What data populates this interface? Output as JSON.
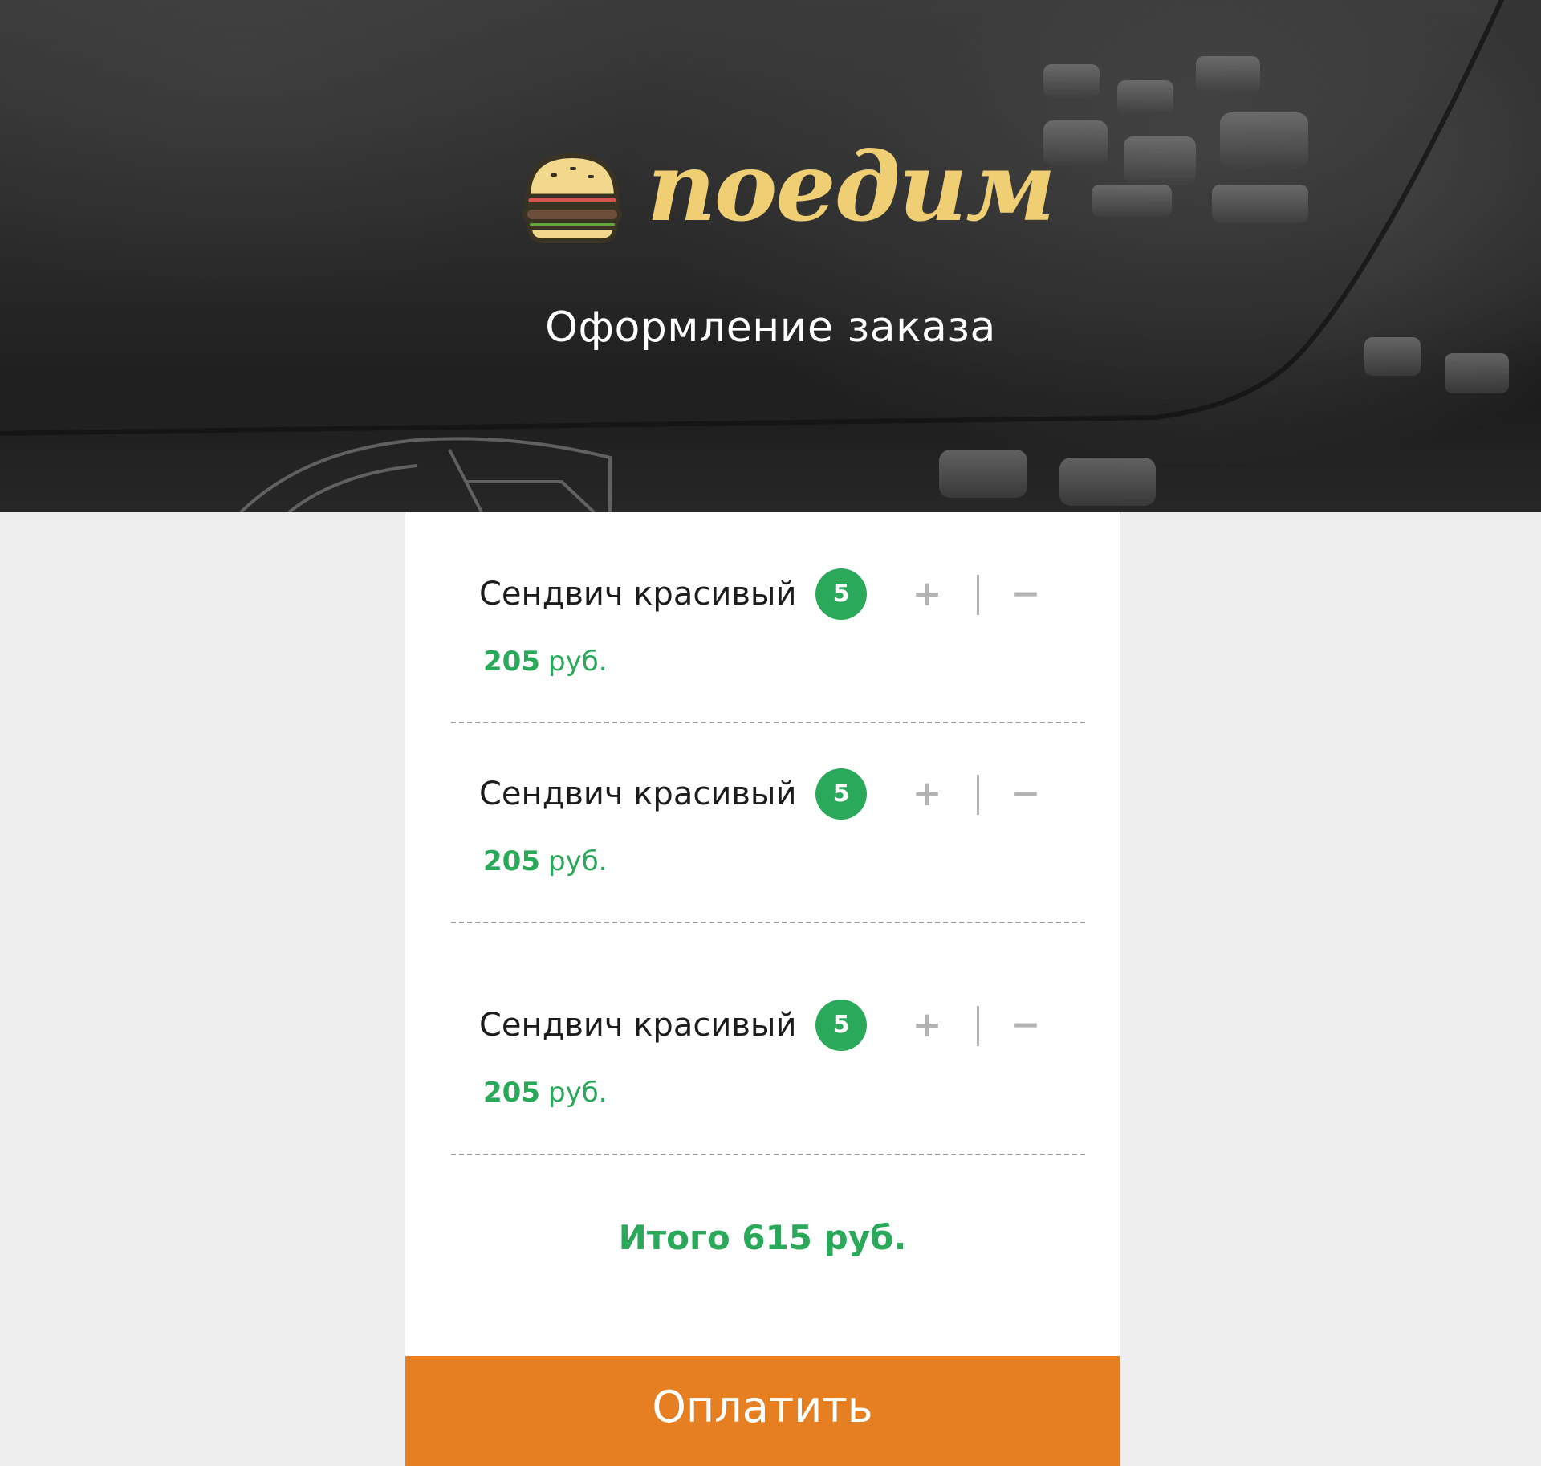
{
  "brand": {
    "name": "поедим",
    "icon": "burger-icon",
    "color": "#f0cf74"
  },
  "header": {
    "title": "Оформление заказа"
  },
  "order": {
    "items": [
      {
        "name": "Сендвич красивый",
        "quantity": "5",
        "plus": "+",
        "minus": "−",
        "price": "205",
        "currency": "руб."
      },
      {
        "name": "Сендвич красивый",
        "quantity": "5",
        "plus": "+",
        "minus": "−",
        "price": "205",
        "currency": "руб."
      },
      {
        "name": "Сендвич красивый",
        "quantity": "5",
        "plus": "+",
        "minus": "−",
        "price": "205",
        "currency": "руб."
      }
    ],
    "total_label": "Итого 615 руб."
  },
  "actions": {
    "pay_label": "Оплатить"
  },
  "colors": {
    "accent_green": "#2aa95b",
    "pay_orange": "#e67e22",
    "page_background": "#eeeeee",
    "muted_control": "#b3b3b3"
  }
}
